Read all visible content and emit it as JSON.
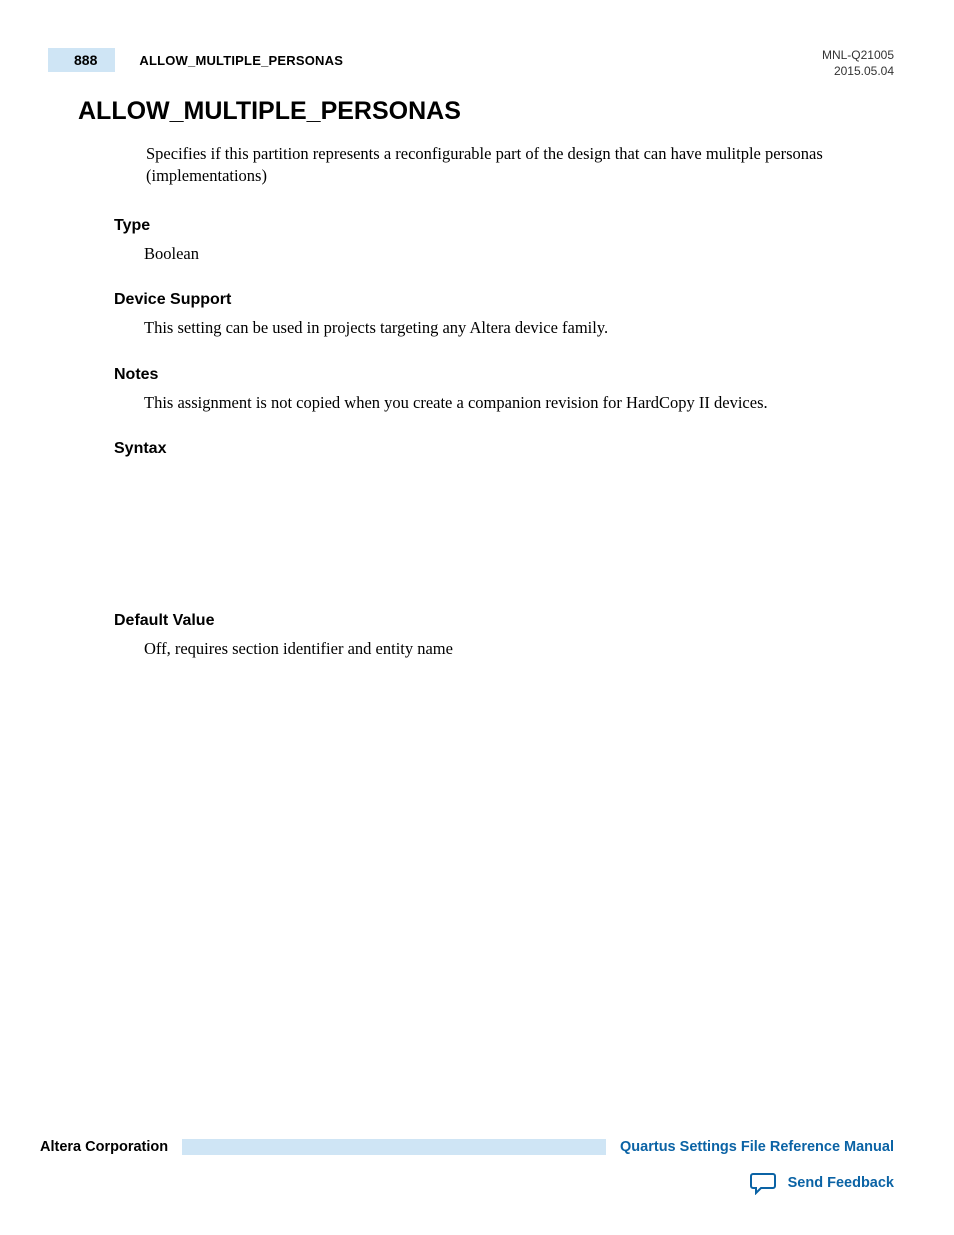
{
  "header": {
    "page_number": "888",
    "breadcrumb": "ALLOW_MULTIPLE_PERSONAS",
    "doc_id": "MNL-Q21005",
    "date": "2015.05.04"
  },
  "title": "ALLOW_MULTIPLE_PERSONAS",
  "intro": "Specifies if this partition represents a reconfigurable part of the design that can have mulitple personas (implementations)",
  "sections": {
    "type": {
      "heading": "Type",
      "body": "Boolean"
    },
    "device_support": {
      "heading": "Device Support",
      "body": "This setting can be used in projects targeting any Altera device family."
    },
    "notes": {
      "heading": "Notes",
      "body": "This assignment is not copied when you create a companion revision for HardCopy II devices."
    },
    "syntax": {
      "heading": "Syntax",
      "body": ""
    },
    "default_value": {
      "heading": "Default Value",
      "body": "Off, requires section identifier and entity name"
    }
  },
  "footer": {
    "company": "Altera Corporation",
    "manual_link": "Quartus Settings File Reference Manual",
    "feedback": "Send Feedback"
  }
}
